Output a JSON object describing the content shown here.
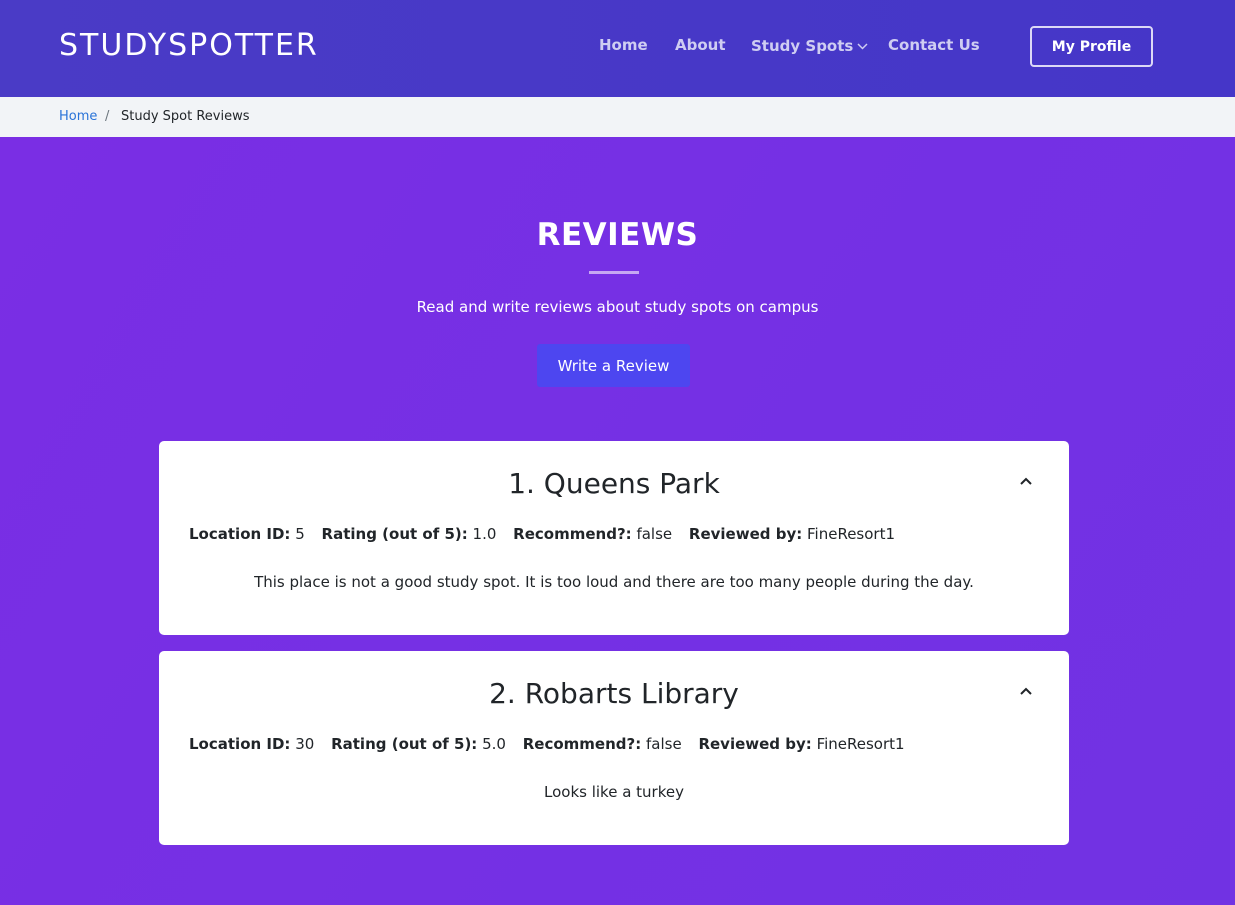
{
  "header": {
    "logo": "STUDYSPOTTER",
    "nav": [
      {
        "label": "Home"
      },
      {
        "label": "About"
      },
      {
        "label": "Study Spots",
        "has_dropdown": true
      },
      {
        "label": "Contact Us"
      }
    ],
    "profile_button": "My Profile"
  },
  "breadcrumb": {
    "home": "Home",
    "separator": "/",
    "current": "Study Spot Reviews"
  },
  "hero": {
    "title": "REVIEWS",
    "subtitle": "Read and write reviews about study spots on campus",
    "write_button": "Write a Review"
  },
  "labels": {
    "location_id": "Location ID:",
    "rating": "Rating (out of 5):",
    "recommend": "Recommend?:",
    "reviewed_by": "Reviewed by:"
  },
  "reviews": [
    {
      "title": "1. Queens Park",
      "location_id": "5",
      "rating": "1.0",
      "recommend": "false",
      "reviewer": "FineResort1",
      "text": "This place is not a good study spot. It is too loud and there are too many people during the day."
    },
    {
      "title": "2. Robarts Library",
      "location_id": "30",
      "rating": "5.0",
      "recommend": "false",
      "reviewer": "FineResort1",
      "text": "Looks like a turkey"
    }
  ],
  "colors": {
    "header_bg": "#4a3bc6",
    "hero_bg": "#7530e4",
    "accent_button": "#4d46f0",
    "link": "#2a73d8"
  },
  "icons": {
    "dropdown": "chevron-down-icon",
    "collapse": "chevron-up-icon"
  }
}
